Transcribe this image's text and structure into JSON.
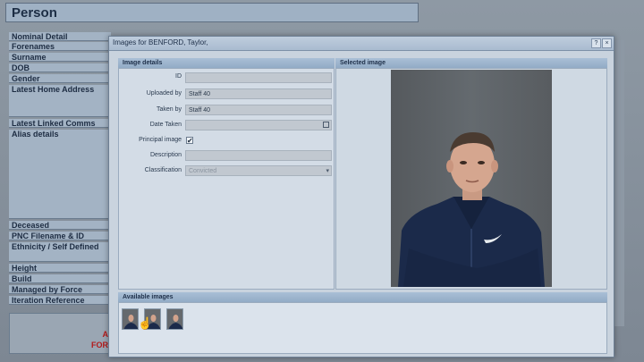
{
  "background": {
    "page_title": "Person",
    "rows": [
      {
        "label": "Nominal Detail",
        "top": 0
      },
      {
        "label": "Forenames"
      },
      {
        "label": "Surname"
      },
      {
        "label": "DOB"
      },
      {
        "label": "Gender"
      },
      {
        "label": "Latest Home Address"
      },
      {
        "label": "Latest Linked Comms"
      },
      {
        "label": "Alias details"
      },
      {
        "label": "Deceased"
      },
      {
        "label": "PNC Filename & ID"
      },
      {
        "label": "Ethnicity / Self Defined"
      },
      {
        "label": "Height"
      },
      {
        "label": "Build"
      },
      {
        "label": "Managed by Force"
      },
      {
        "label": "Iteration Reference"
      }
    ],
    "red_text_1": "A",
    "red_text_2": "FOR"
  },
  "dialog": {
    "title": "Images for BENFORD, Taylor,",
    "help_button": "?",
    "close_button": "×",
    "details_header": "Image details",
    "selected_header": "Selected image",
    "available_header": "Available images",
    "fields": {
      "id_label": "ID",
      "id_value": "",
      "uploaded_by_label": "Uploaded by",
      "uploaded_by_value": "Staff 40",
      "taken_by_label": "Taken by",
      "taken_by_value": "Staff 40",
      "date_taken_label": "Date Taken",
      "date_taken_value": "",
      "principal_label": "Principal image",
      "principal_checked": "✔",
      "description_label": "Description",
      "description_value": "",
      "classification_label": "Classification",
      "classification_value": "Convicted"
    },
    "colors": {
      "header": "#9fb6cf",
      "dialog_bg": "#c9d3de"
    }
  }
}
